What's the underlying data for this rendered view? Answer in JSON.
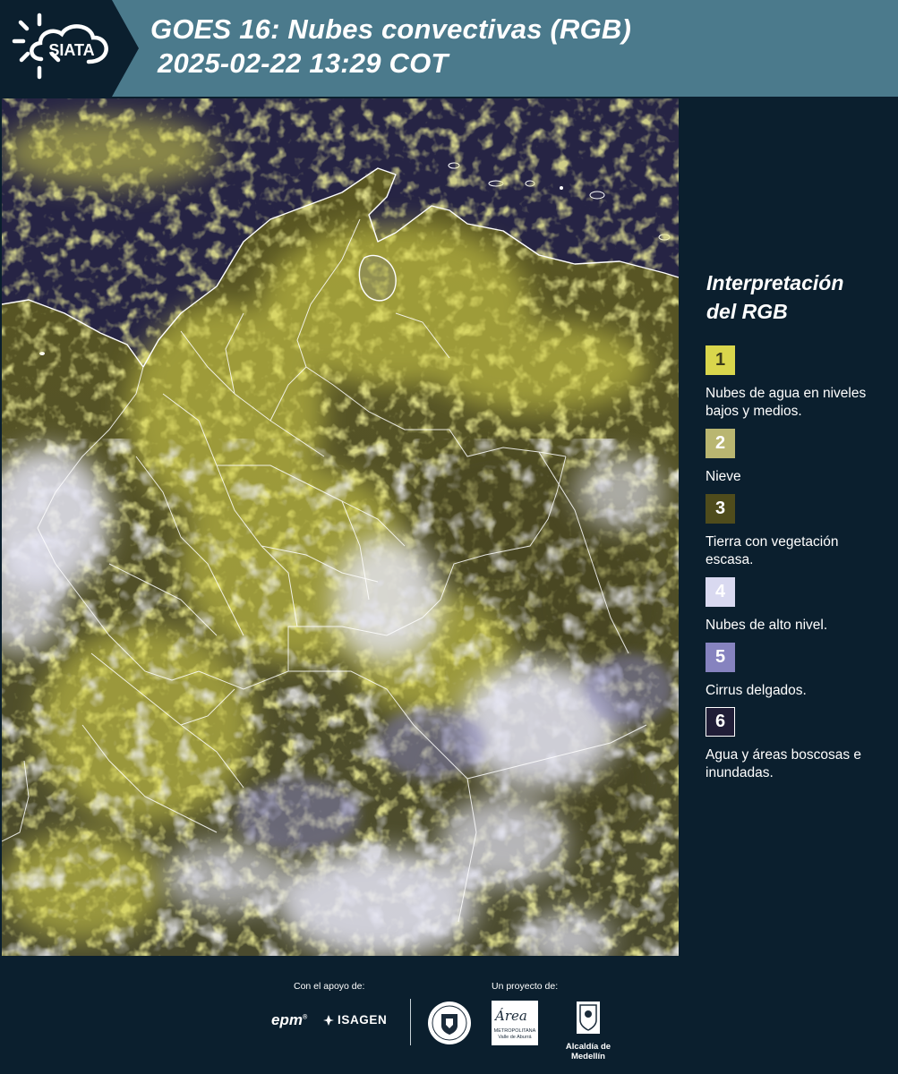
{
  "header": {
    "logo_text": "SIATA",
    "title_line1": "GOES 16: Nubes convectivas (RGB)",
    "title_line2": "2025-02-22 13:29 COT",
    "background_color": "#4b7a8c",
    "logo_panel_color": "#0b1f2e"
  },
  "legend": {
    "title_line1": "Interpretación",
    "title_line2": "del RGB",
    "items": [
      {
        "number": "1",
        "label": "Nubes de agua en niveles bajos y medios.",
        "color": "#d9d64c",
        "text_color": "#3a3a1a"
      },
      {
        "number": "2",
        "label": "Nieve",
        "color": "#b9b671",
        "text_color": "#ffffff"
      },
      {
        "number": "3",
        "label": "Tierra con vegetación escasa.",
        "color": "#4f4c1c",
        "text_color": "#ffffff"
      },
      {
        "number": "4",
        "label": "Nubes de alto nivel.",
        "color": "#d9d9f0",
        "text_color": "#ffffff"
      },
      {
        "number": "5",
        "label": "Cirrus delgados.",
        "color": "#8683bf",
        "text_color": "#ffffff"
      },
      {
        "number": "6",
        "label": "Agua y áreas boscosas e inundadas.",
        "color": "#201d37",
        "text_color": "#ffffff"
      }
    ]
  },
  "footer": {
    "support_label": "Con el apoyo de:",
    "project_label": "Un proyecto de:",
    "sponsors": {
      "epm": "epm",
      "isagen": "ISAGEN",
      "amva_title": "Área",
      "amva_subtitle_1": "METROPOLITANA",
      "amva_subtitle_2": "Valle de Aburrá",
      "medellin": "Alcaldía de Medellín"
    }
  },
  "map": {
    "ocean_color": "#262444",
    "low_cloud_color": "#d9d64c",
    "high_cloud_color": "#e6e6f6",
    "border_color": "#ffffff"
  }
}
